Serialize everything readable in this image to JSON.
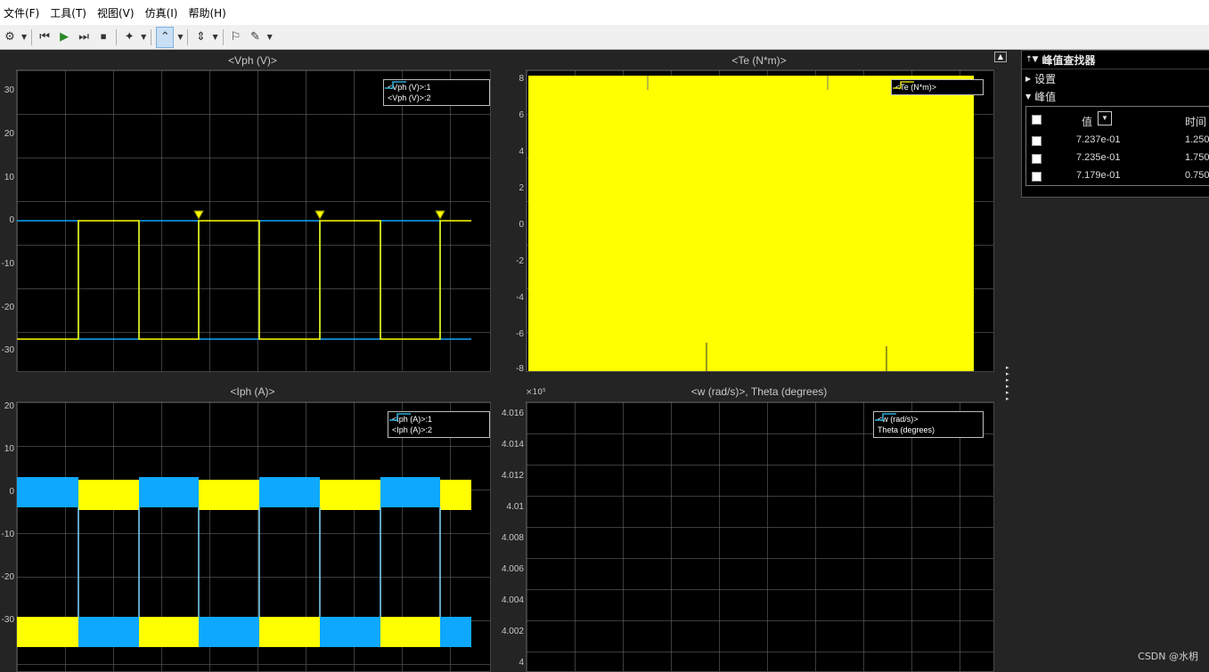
{
  "menu": [
    "文件(F)",
    "工具(T)",
    "视图(V)",
    "仿真(I)",
    "帮助(H)"
  ],
  "plots": {
    "vph": {
      "title": "<Vph (V)>",
      "yticks": [
        "30",
        "20",
        "10",
        "0",
        "-10",
        "-20",
        "-30"
      ],
      "legend": [
        "<Vph (V)>:1",
        "<Vph (V)>:2"
      ]
    },
    "te": {
      "title": "<Te (N*m)>",
      "yticks": [
        "8",
        "6",
        "4",
        "2",
        "0",
        "-2",
        "-4",
        "-6",
        "-8"
      ],
      "legend": [
        "<Te (N*m)>"
      ]
    },
    "iph": {
      "title": "<Iph (A)>",
      "yticks": [
        "20",
        "10",
        "0",
        "-10",
        "-20",
        "-30"
      ],
      "legend": [
        "<Iph (A)>:1",
        "<Iph (A)>:2"
      ]
    },
    "w": {
      "title": "<w (rad/s)>, Theta (degrees)",
      "multiplier": "×10⁵",
      "yticks": [
        "4.016",
        "4.014",
        "4.012",
        "4.01",
        "4.008",
        "4.006",
        "4.004",
        "4.002",
        "4"
      ],
      "legend": [
        "<w (rad/s)>",
        "Theta (degrees)"
      ]
    }
  },
  "peak_finder": {
    "title": "峰值查找器",
    "settings_label": "设置",
    "peaks_label": "峰值",
    "col_value": "值",
    "col_time": "时间",
    "rows": [
      {
        "value": "7.237e-01",
        "time": "1.250"
      },
      {
        "value": "7.235e-01",
        "time": "1.750"
      },
      {
        "value": "7.179e-01",
        "time": "0.750"
      }
    ]
  },
  "watermark": "CSDN @水枂",
  "colors": {
    "series1": "#ffff00",
    "series2": "#0fa8ff",
    "background": "#000000"
  }
}
